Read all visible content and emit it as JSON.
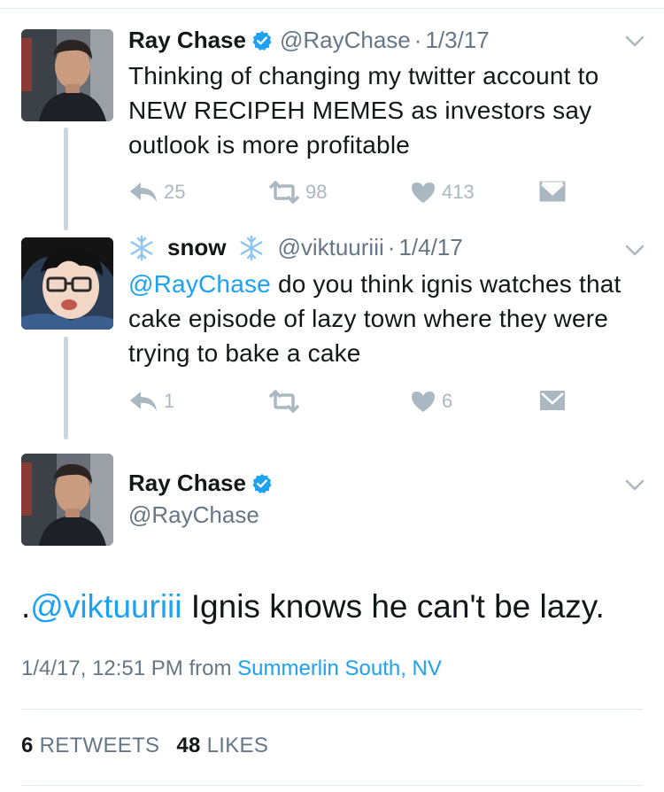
{
  "tweets": [
    {
      "name": "Ray Chase",
      "handle": "@RayChase",
      "separator": "·",
      "date": "1/3/17",
      "text": "Thinking of changing my twitter account to NEW RECIPEH MEMES as investors say outlook is more profitable",
      "replies": "25",
      "retweets": "98",
      "likes": "413",
      "verified": true
    },
    {
      "name": "snow",
      "handle": "@viktuuriii",
      "separator": "·",
      "date": "1/4/17",
      "mention": "@RayChase",
      "text": " do you think ignis watches that cake episode of lazy town where they were trying to bake a cake",
      "replies": "1",
      "retweets": "",
      "likes": "6",
      "name_decoration_icon": "snowflake-icon"
    }
  ],
  "main_tweet": {
    "name": "Ray Chase",
    "handle": "@RayChase",
    "verified": true,
    "prefix": ".",
    "mention": "@viktuuriii",
    "text": " Ignis knows he can't be lazy.",
    "timestamp": "1/4/17, 12:51 PM from ",
    "location": "Summerlin South, NV",
    "retweet_count": "6",
    "retweet_label": "RETWEETS",
    "like_count": "48",
    "like_label": "LIKES"
  },
  "colors": {
    "link": "#1da1f2",
    "secondary": "#657786",
    "action_icon": "#aab8c2",
    "divider": "#e1e8ed",
    "thread_line": "#ccd6dd"
  },
  "icons": {
    "reply": "reply-icon",
    "retweet": "retweet-icon",
    "like": "heart-icon",
    "dm": "envelope-icon",
    "more": "chevron-down-icon",
    "verified": "verified-badge-icon"
  }
}
